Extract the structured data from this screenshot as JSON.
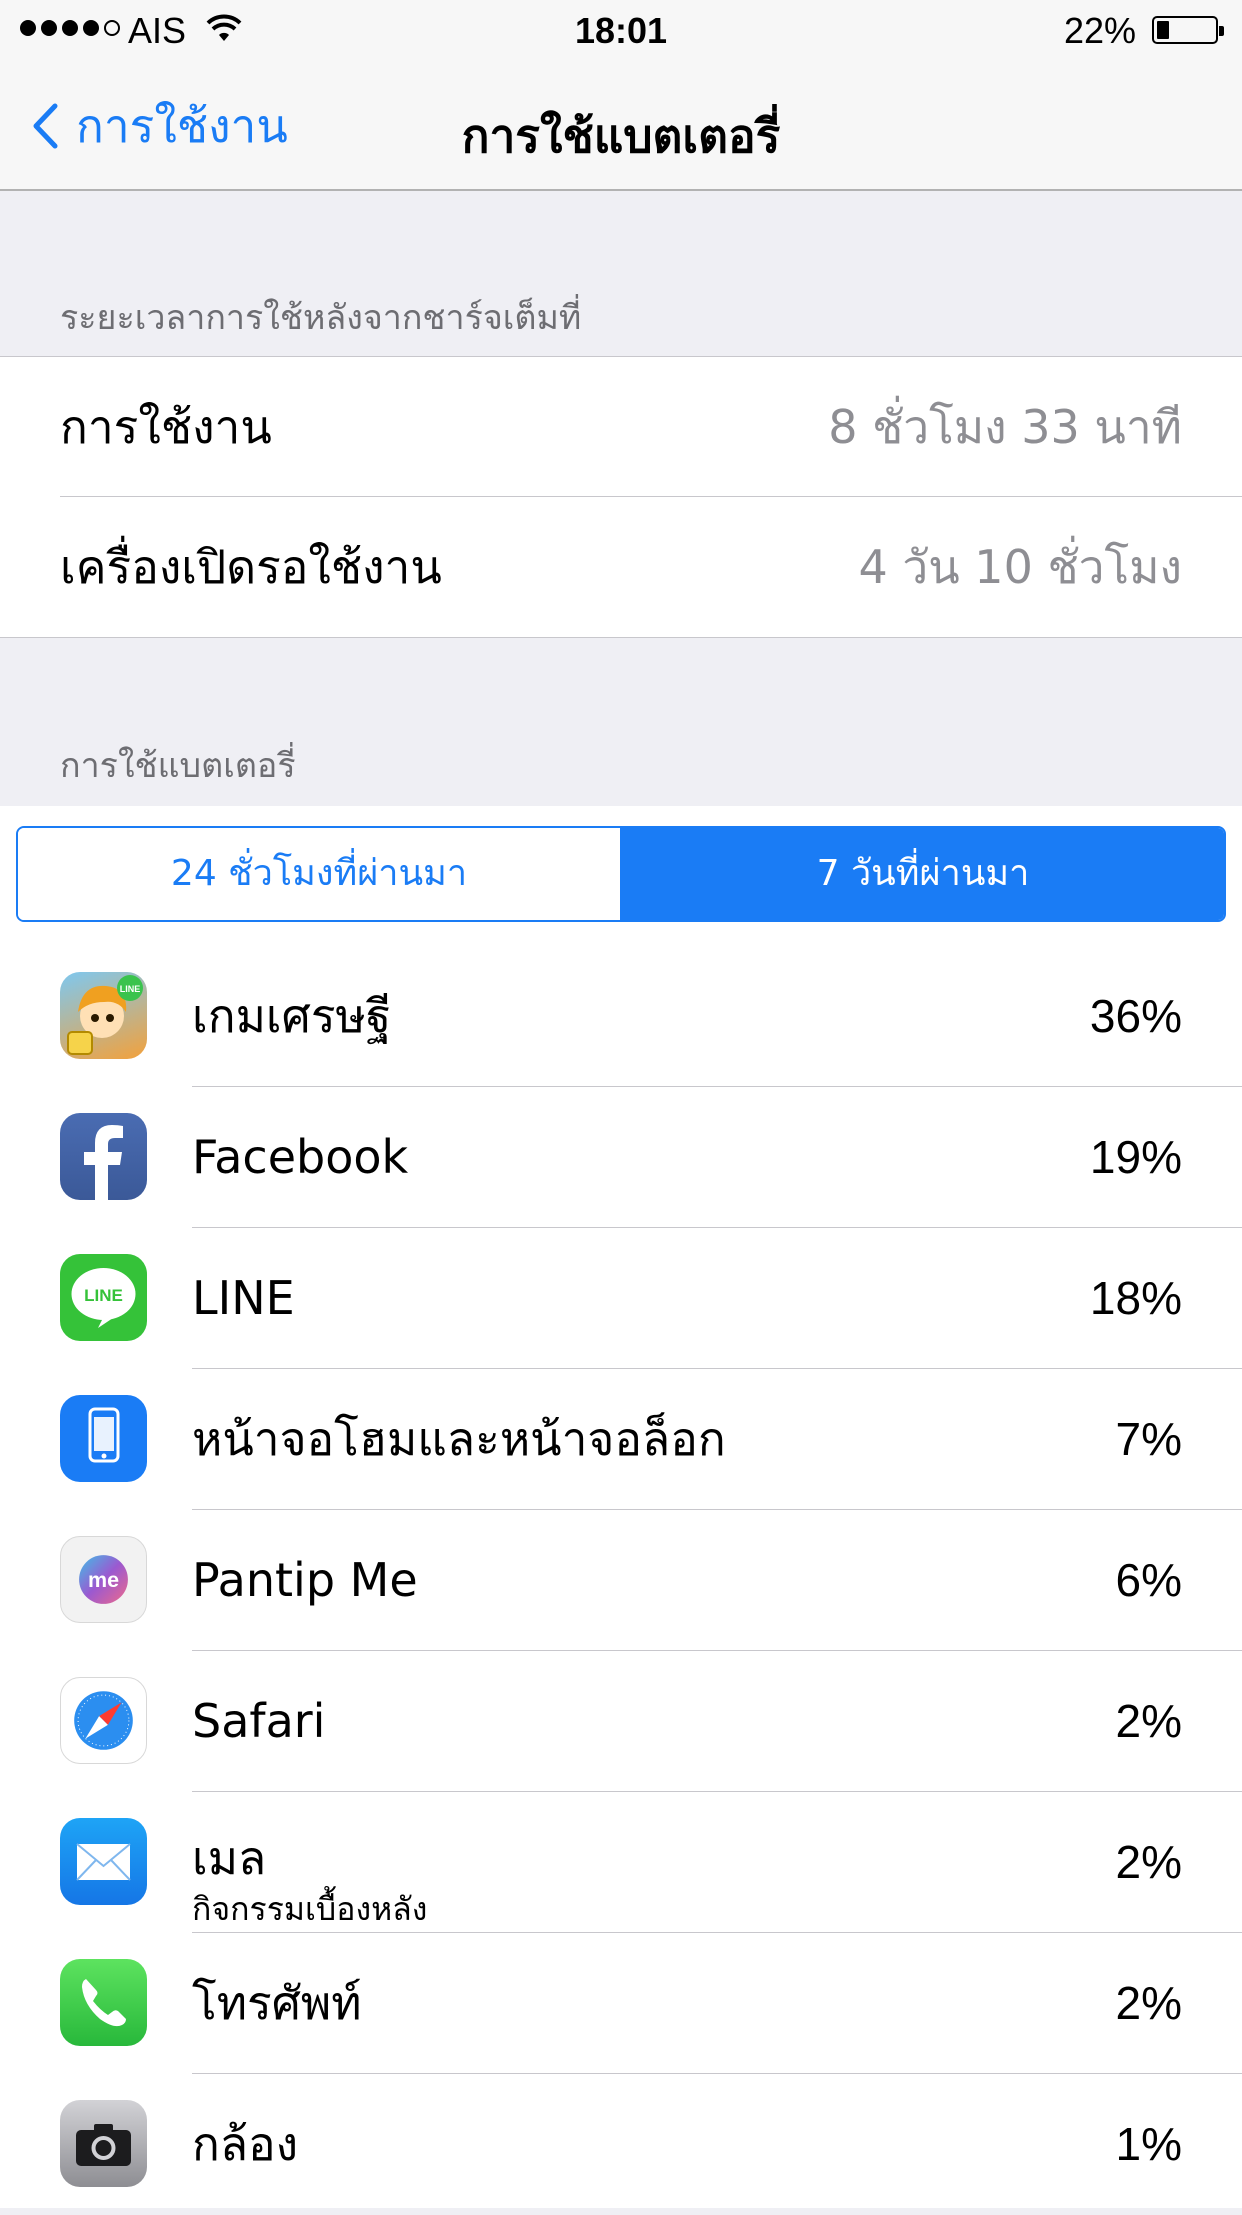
{
  "status_bar": {
    "carrier": "AIS",
    "time": "18:01",
    "battery_percent": "22%",
    "battery_level": 0.22
  },
  "nav": {
    "back_label": "การใช้งาน",
    "title": "การใช้แบตเตอรี่"
  },
  "since_charge": {
    "header": "ระยะเวลาการใช้หลังจากชาร์จเต็มที่",
    "rows": [
      {
        "label": "การใช้งาน",
        "value": "8 ชั่วโมง 33 นาที"
      },
      {
        "label": "เครื่องเปิดรอใช้งาน",
        "value": "4 วัน 10 ชั่วโมง"
      }
    ]
  },
  "battery_usage": {
    "header": "การใช้แบตเตอรี่",
    "segments": [
      {
        "label": "24 ชั่วโมงที่ผ่านมา",
        "selected": false
      },
      {
        "label": "7 วันที่ผ่านมา",
        "selected": true
      }
    ],
    "apps": [
      {
        "name": "เกมเศรษฐี",
        "subtitle": "",
        "percent": "36%",
        "icon": "game-icon"
      },
      {
        "name": "Facebook",
        "subtitle": "",
        "percent": "19%",
        "icon": "facebook-icon"
      },
      {
        "name": "LINE",
        "subtitle": "",
        "percent": "18%",
        "icon": "line-icon"
      },
      {
        "name": "หน้าจอโฮมและหน้าจอล็อก",
        "subtitle": "",
        "percent": "7%",
        "icon": "phone-screen-icon"
      },
      {
        "name": "Pantip Me",
        "subtitle": "",
        "percent": "6%",
        "icon": "pantip-me-icon"
      },
      {
        "name": "Safari",
        "subtitle": "",
        "percent": "2%",
        "icon": "safari-icon"
      },
      {
        "name": "เมล",
        "subtitle": "กิจกรรมเบื้องหลัง",
        "percent": "2%",
        "icon": "mail-icon"
      },
      {
        "name": "โทรศัพท์",
        "subtitle": "",
        "percent": "2%",
        "icon": "phone-icon"
      },
      {
        "name": "กล้อง",
        "subtitle": "",
        "percent": "1%",
        "icon": "camera-icon"
      }
    ]
  },
  "colors": {
    "accent": "#1a7cf5",
    "background": "#efeff4",
    "secondary_text": "#8e8e93"
  }
}
